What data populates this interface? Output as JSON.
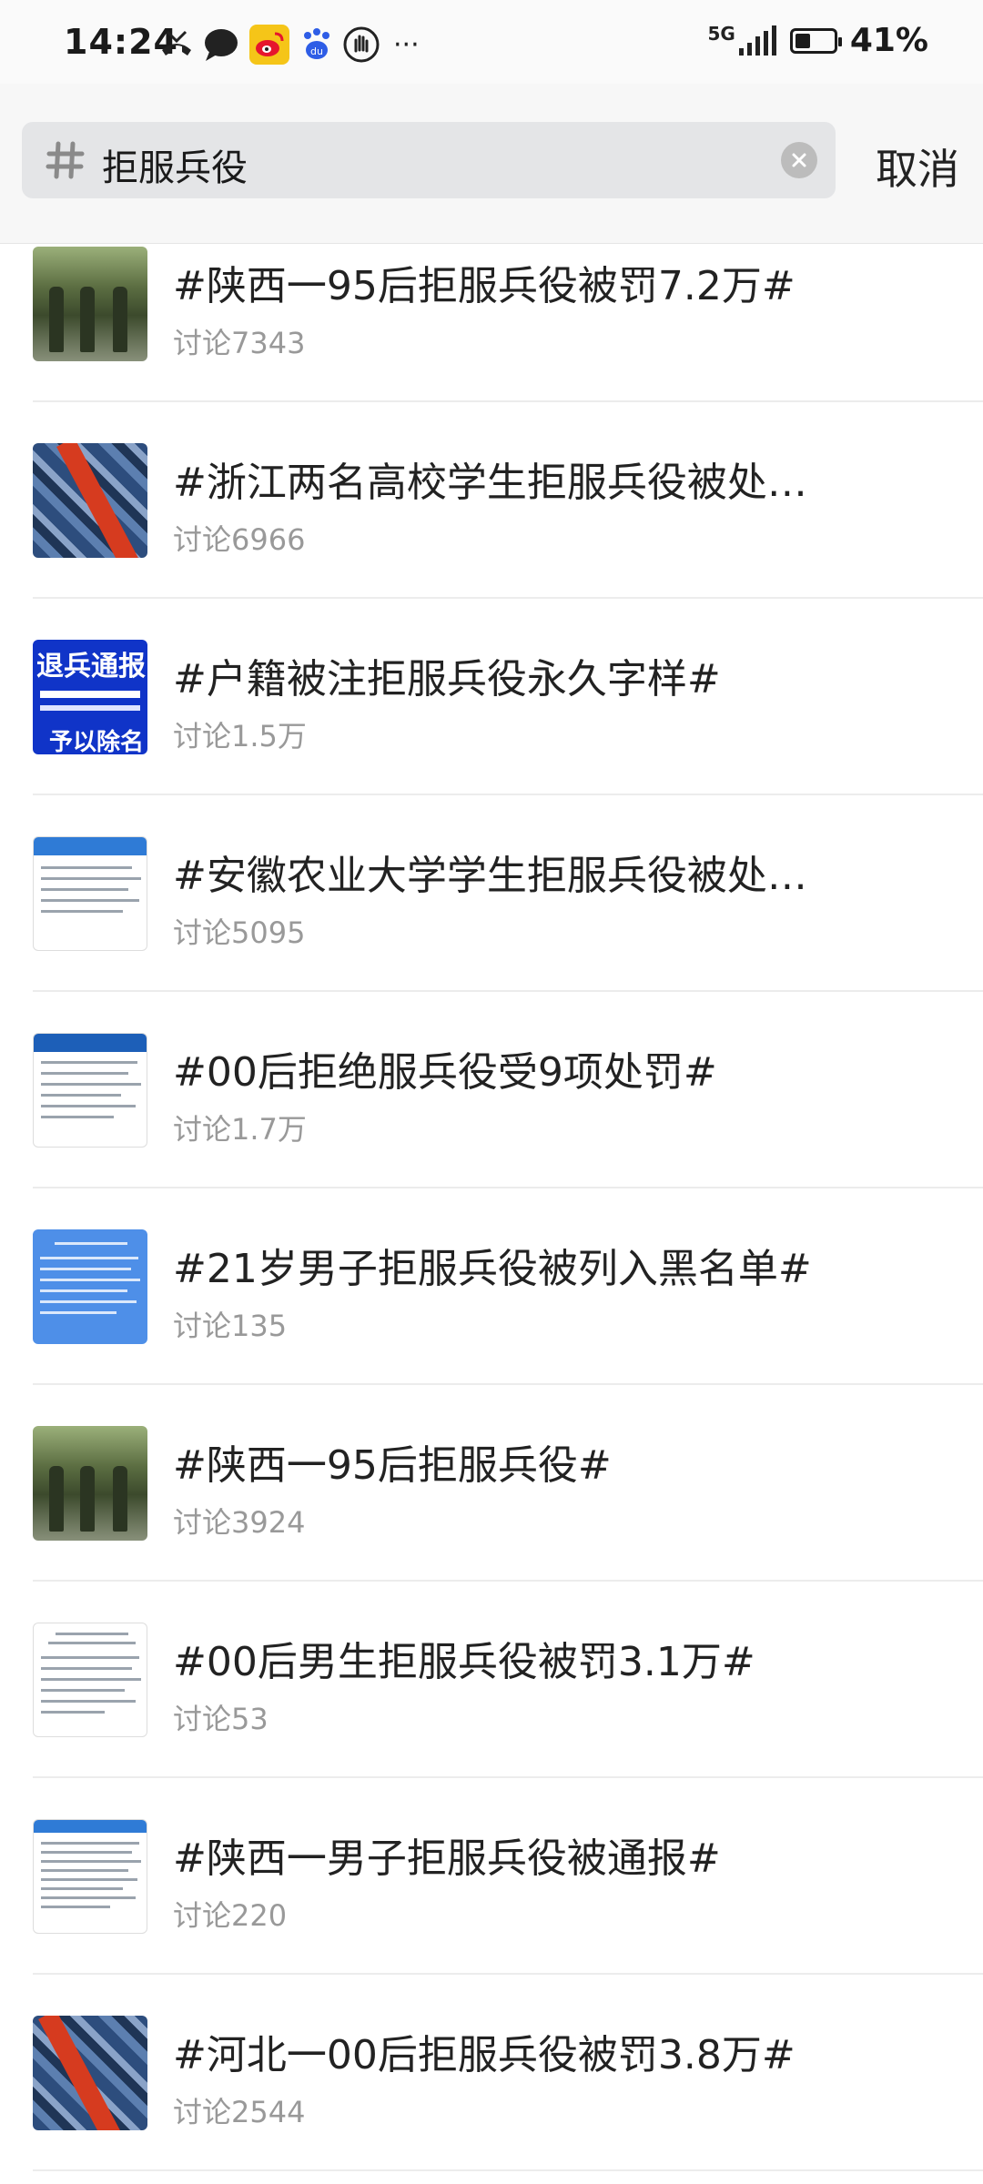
{
  "status_bar": {
    "time": "14:24",
    "network": "5G",
    "battery_percent": "41%",
    "battery_level": 0.41,
    "notification_icons": [
      "missed-call-icon",
      "chat-bubble-icon",
      "weibo-icon",
      "baidu-paw-icon",
      "hand-icon",
      "more-dots-icon"
    ],
    "more_label": "···"
  },
  "search": {
    "query": "拒服兵役",
    "cancel_label": "取消"
  },
  "results": [
    {
      "title": "#陕西一95后拒服兵役被罚7.2万#",
      "meta": "讨论7343",
      "thumb": "soldiers"
    },
    {
      "title": "#浙江两名高校学生拒服兵役被处…",
      "meta": "讨论6966",
      "thumb": "camo"
    },
    {
      "title": "#户籍被注拒服兵役永久字样#",
      "meta": "讨论1.5万",
      "thumb": "notice"
    },
    {
      "title": "#安徽农业大学学生拒服兵役被处…",
      "meta": "讨论5095",
      "thumb": "doc"
    },
    {
      "title": "#00后拒绝服兵役受9项处罚#",
      "meta": "讨论1.7万",
      "thumb": "doc"
    },
    {
      "title": "#21岁男子拒服兵役被列入黑名单#",
      "meta": "讨论135",
      "thumb": "blue"
    },
    {
      "title": "#陕西一95后拒服兵役#",
      "meta": "讨论3924",
      "thumb": "soldiers"
    },
    {
      "title": "#00后男生拒服兵役被罚3.1万#",
      "meta": "讨论53",
      "thumb": "doc"
    },
    {
      "title": "#陕西一男子拒服兵役被通报#",
      "meta": "讨论220",
      "thumb": "doc"
    },
    {
      "title": "#河北一00后拒服兵役被罚3.8万#",
      "meta": "讨论2544",
      "thumb": "camo"
    }
  ],
  "thumbnail_text": {
    "notice_line1": "退兵通报",
    "notice_line2": "予以除名"
  }
}
